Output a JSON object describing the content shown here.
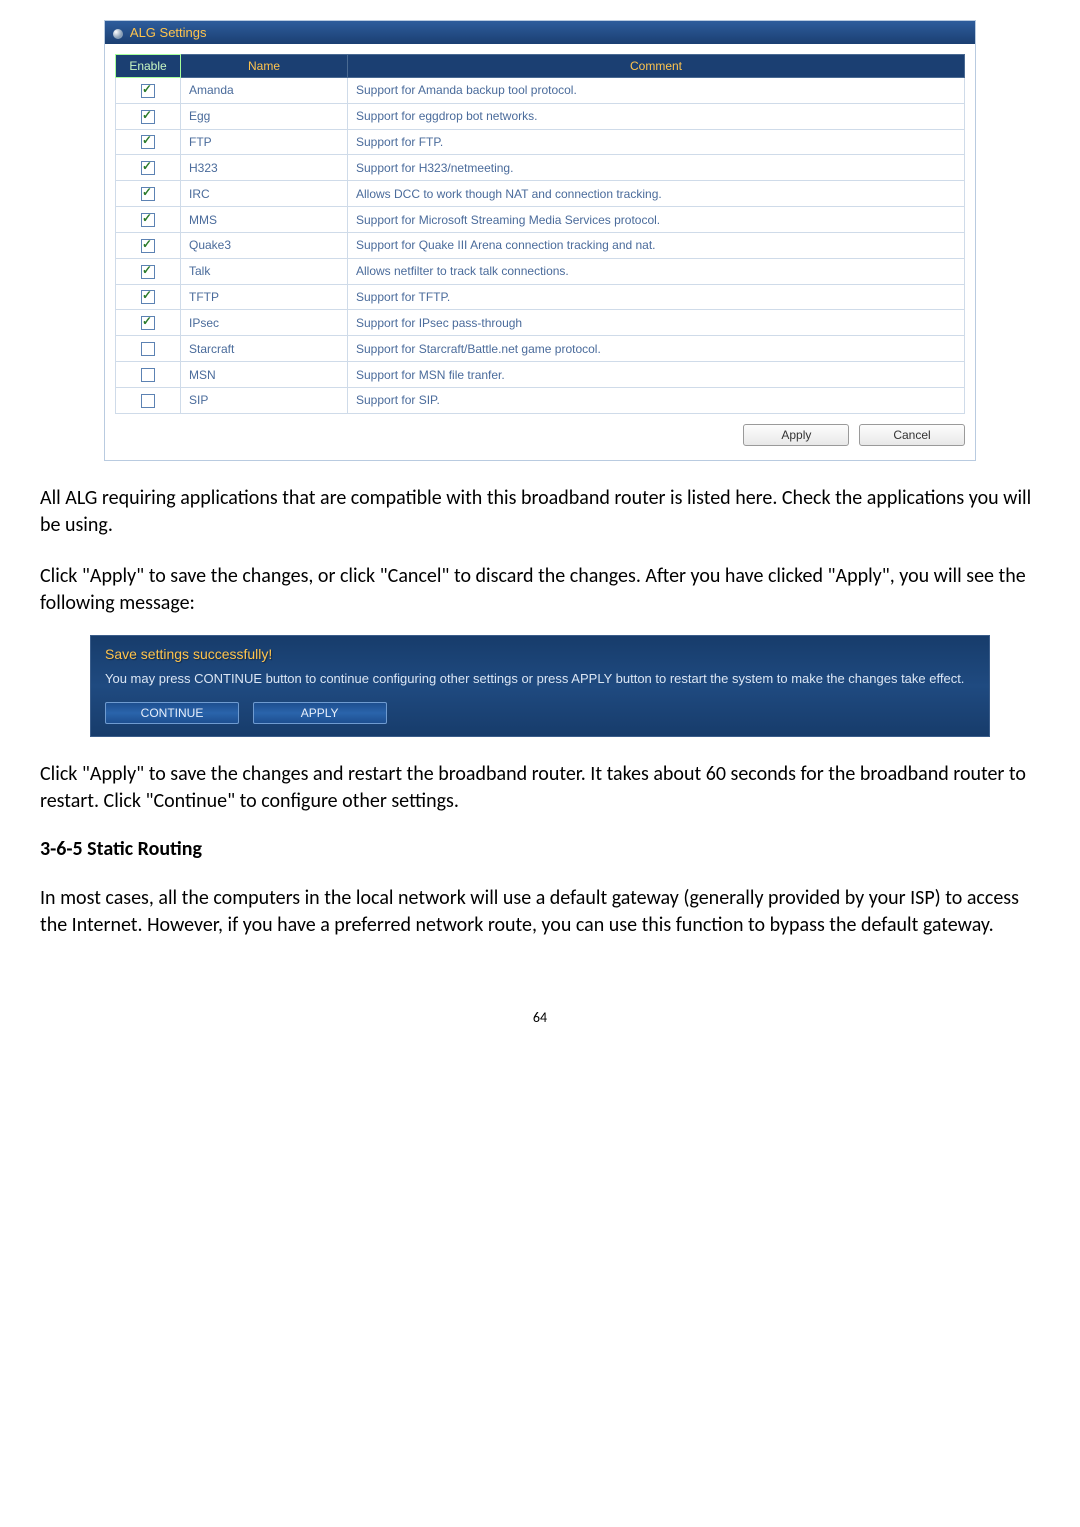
{
  "alg": {
    "panel_title": "ALG Settings",
    "headers": {
      "enable": "Enable",
      "name": "Name",
      "comment": "Comment"
    },
    "rows": [
      {
        "checked": true,
        "name": "Amanda",
        "comment": "Support for Amanda backup tool protocol."
      },
      {
        "checked": true,
        "name": "Egg",
        "comment": "Support for eggdrop bot networks."
      },
      {
        "checked": true,
        "name": "FTP",
        "comment": "Support for FTP."
      },
      {
        "checked": true,
        "name": "H323",
        "comment": "Support for H323/netmeeting."
      },
      {
        "checked": true,
        "name": "IRC",
        "comment": "Allows DCC to work though NAT and connection tracking."
      },
      {
        "checked": true,
        "name": "MMS",
        "comment": "Support for Microsoft Streaming Media Services protocol."
      },
      {
        "checked": true,
        "name": "Quake3",
        "comment": "Support for Quake III Arena connection tracking and nat."
      },
      {
        "checked": true,
        "name": "Talk",
        "comment": "Allows netfilter to track talk connections."
      },
      {
        "checked": true,
        "name": "TFTP",
        "comment": "Support for TFTP."
      },
      {
        "checked": true,
        "name": "IPsec",
        "comment": "Support for IPsec pass-through"
      },
      {
        "checked": false,
        "name": "Starcraft",
        "comment": "Support for Starcraft/Battle.net game protocol."
      },
      {
        "checked": false,
        "name": "MSN",
        "comment": "Support for MSN file tranfer."
      },
      {
        "checked": false,
        "name": "SIP",
        "comment": "Support for SIP."
      }
    ],
    "apply": "Apply",
    "cancel": "Cancel"
  },
  "para1": "All ALG requiring applications that are compatible with this broadband router is listed here. Check the applications you will be using.",
  "para2": "Click \"Apply\" to save the changes, or click \"Cancel\" to discard the changes. After you have clicked \"Apply\", you will see the following message:",
  "save": {
    "title": "Save settings successfully!",
    "msg": "You may press CONTINUE button to continue configuring other settings or press APPLY button to restart the system to make the changes take effect.",
    "continue": "CONTINUE",
    "apply": "APPLY"
  },
  "para3": "Click \"Apply\" to save the changes and restart the broadband router. It takes about 60 seconds for the broadband router to restart. Click \"Continue\" to configure other settings.",
  "heading": "3-6-5 Static Routing",
  "para4": "In most cases, all the computers in the local network will use a default gateway (generally provided by your ISP) to access the Internet. However, if you have a preferred network route, you can use this function to bypass the default gateway.",
  "pagenum": "64"
}
